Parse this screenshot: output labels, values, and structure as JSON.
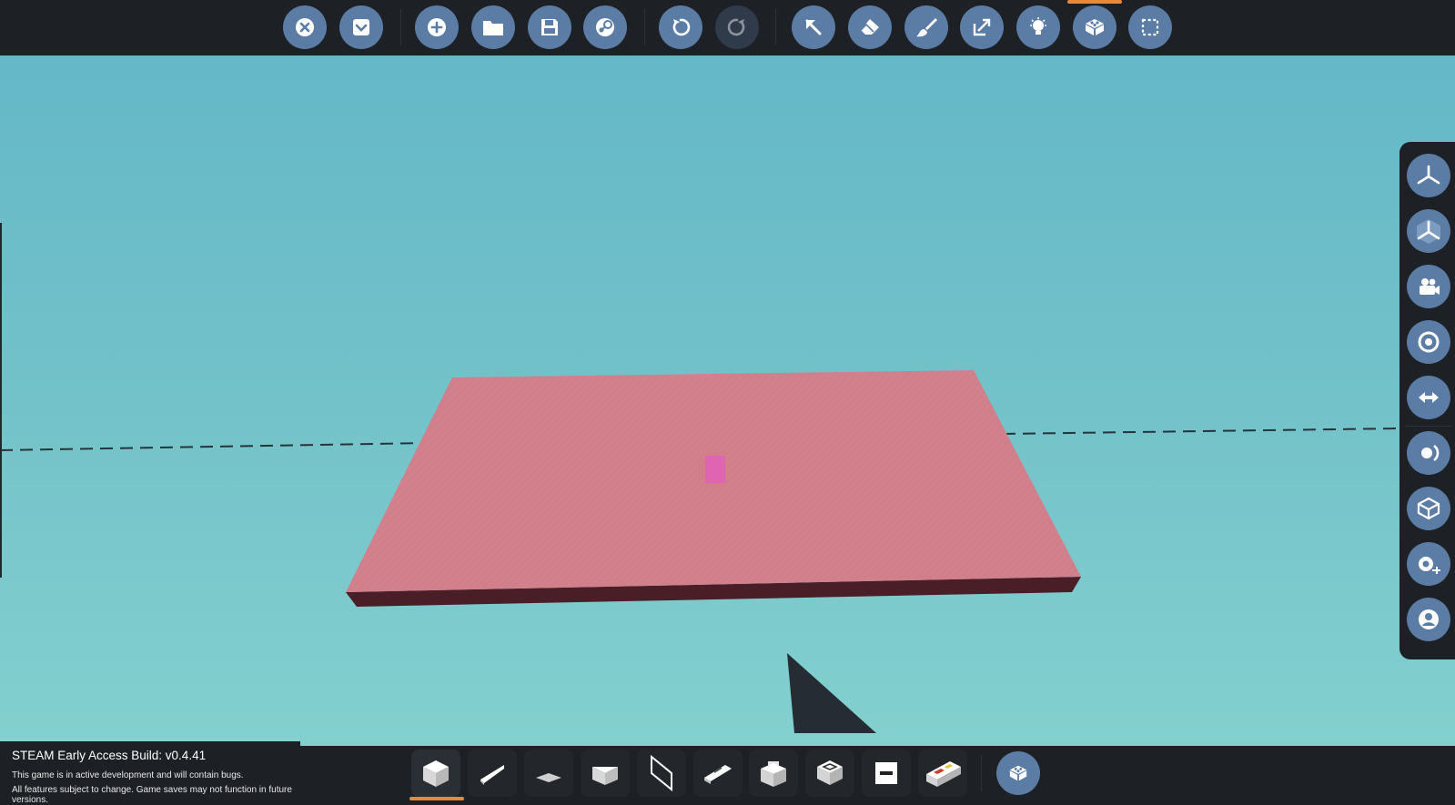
{
  "colors": {
    "toolbar_bg": "#1d2024",
    "button": "#5b7ca5",
    "button_disabled": "#2f3b4b",
    "accent": "#e68a3a",
    "sky_top": "#64b8c8",
    "sky_bottom": "#83d0cf",
    "plate_top": "#d3808d",
    "plate_side": "#4a1e26",
    "marker": "#e060b8"
  },
  "top_toolbar": [
    {
      "name": "close-icon",
      "state": "enabled"
    },
    {
      "name": "collapse-menu-icon",
      "state": "enabled"
    },
    {
      "name": "new-icon",
      "state": "enabled"
    },
    {
      "name": "open-folder-icon",
      "state": "enabled"
    },
    {
      "name": "save-icon",
      "state": "enabled"
    },
    {
      "name": "steam-icon",
      "state": "enabled"
    },
    {
      "name": "undo-icon",
      "state": "enabled"
    },
    {
      "name": "redo-icon",
      "state": "disabled"
    },
    {
      "name": "select-cursor-icon",
      "state": "enabled"
    },
    {
      "name": "eraser-icon",
      "state": "enabled"
    },
    {
      "name": "paint-brush-icon",
      "state": "enabled"
    },
    {
      "name": "scale-arrow-icon",
      "state": "enabled"
    },
    {
      "name": "lightbulb-icon",
      "state": "enabled"
    },
    {
      "name": "bricks-icon",
      "state": "active"
    },
    {
      "name": "selection-box-icon",
      "state": "enabled"
    }
  ],
  "right_toolbar": [
    {
      "name": "axis-view-icon"
    },
    {
      "name": "axis-view-boxed-icon"
    },
    {
      "name": "camera-icon"
    },
    {
      "name": "target-icon"
    },
    {
      "name": "swap-arrow-icon"
    },
    {
      "name": "rotate-view-icon"
    },
    {
      "name": "cube-view-icon"
    },
    {
      "name": "camera-tools-icon"
    },
    {
      "name": "character-icon"
    }
  ],
  "parts_bar": [
    {
      "name": "cube-part-icon",
      "selected": true
    },
    {
      "name": "wedge-part-icon",
      "selected": false
    },
    {
      "name": "flat-plate-part-icon",
      "selected": false
    },
    {
      "name": "slope-part-icon",
      "selected": false
    },
    {
      "name": "panel-part-icon",
      "selected": false
    },
    {
      "name": "hinge-part-icon",
      "selected": false
    },
    {
      "name": "stud-block-part-icon",
      "selected": false
    },
    {
      "name": "outline-block-part-icon",
      "selected": false
    },
    {
      "name": "switch-part-icon",
      "selected": false
    },
    {
      "name": "controller-part-icon",
      "selected": false
    },
    {
      "name": "bricks-menu-icon",
      "selected": false
    }
  ],
  "build_info": {
    "title": "STEAM Early Access Build: v0.4.41",
    "line1": "This game is in active development and will contain bugs.",
    "line2": "All features subject to change. Game saves may not function in future versions."
  }
}
